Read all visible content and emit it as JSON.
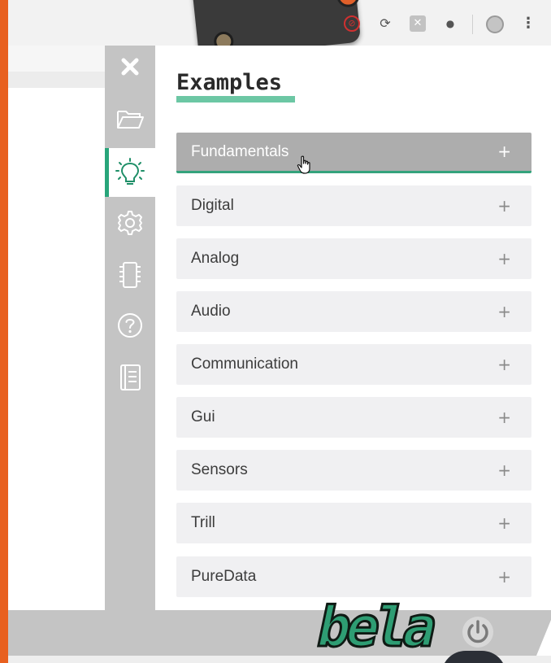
{
  "panel": {
    "title": "Examples"
  },
  "categories": [
    {
      "label": "Fundamentals",
      "expand_symbol": "+",
      "active": true
    },
    {
      "label": "Digital",
      "expand_symbol": "+"
    },
    {
      "label": "Analog",
      "expand_symbol": "+"
    },
    {
      "label": "Audio",
      "expand_symbol": "+"
    },
    {
      "label": "Communication",
      "expand_symbol": "+"
    },
    {
      "label": "Gui",
      "expand_symbol": "+"
    },
    {
      "label": "Sensors",
      "expand_symbol": "+"
    },
    {
      "label": "Trill",
      "expand_symbol": "+"
    },
    {
      "label": "PureData",
      "expand_symbol": "+"
    }
  ],
  "sidebar": {
    "items": [
      {
        "icon": "close-icon"
      },
      {
        "icon": "folder-icon"
      },
      {
        "icon": "lightbulb-icon",
        "active": true
      },
      {
        "icon": "gear-icon"
      },
      {
        "icon": "chip-icon"
      },
      {
        "icon": "help-icon"
      },
      {
        "icon": "book-icon"
      }
    ]
  },
  "browser": {
    "more_glyph": "⋮"
  },
  "footer": {
    "logo": "bela"
  },
  "colors": {
    "accent": "#28a57a",
    "sidebar_bg": "#c4c4c4",
    "active_row": "#adadad",
    "row_bg": "#f0f0f2",
    "outer_frame": "#e8601f"
  }
}
